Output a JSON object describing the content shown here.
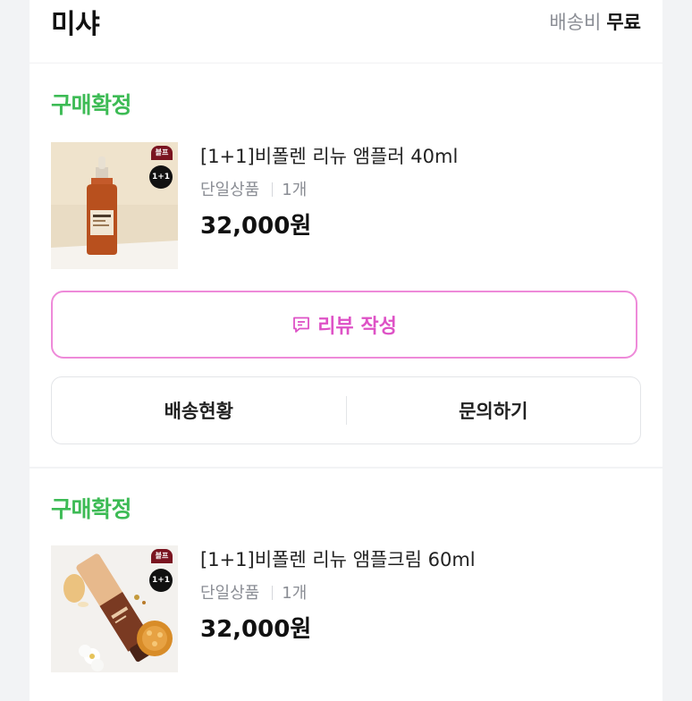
{
  "store": {
    "name": "미샤",
    "shipping_label": "배송비",
    "shipping_value": "무료"
  },
  "orders": [
    {
      "status": "구매확정",
      "product_name": "[1+1]비폴렌 리뉴 앰플러 40ml",
      "option": "단일상품",
      "quantity": "1개",
      "price": "32,000원",
      "badge_top": "블프",
      "badge_promo": "1+1",
      "review_button": "리뷰 작성",
      "shipping_status_button": "배송현황",
      "inquiry_button": "문의하기"
    },
    {
      "status": "구매확정",
      "product_name": "[1+1]비폴렌 리뉴 앰플크림 60ml",
      "option": "단일상품",
      "quantity": "1개",
      "price": "32,000원",
      "badge_top": "블프",
      "badge_promo": "1+1"
    }
  ],
  "colors": {
    "status_green": "#3dbb55",
    "review_pink": "#de52c6",
    "review_border": "#ee8ad9"
  },
  "icons": {
    "review": "comment-icon"
  }
}
